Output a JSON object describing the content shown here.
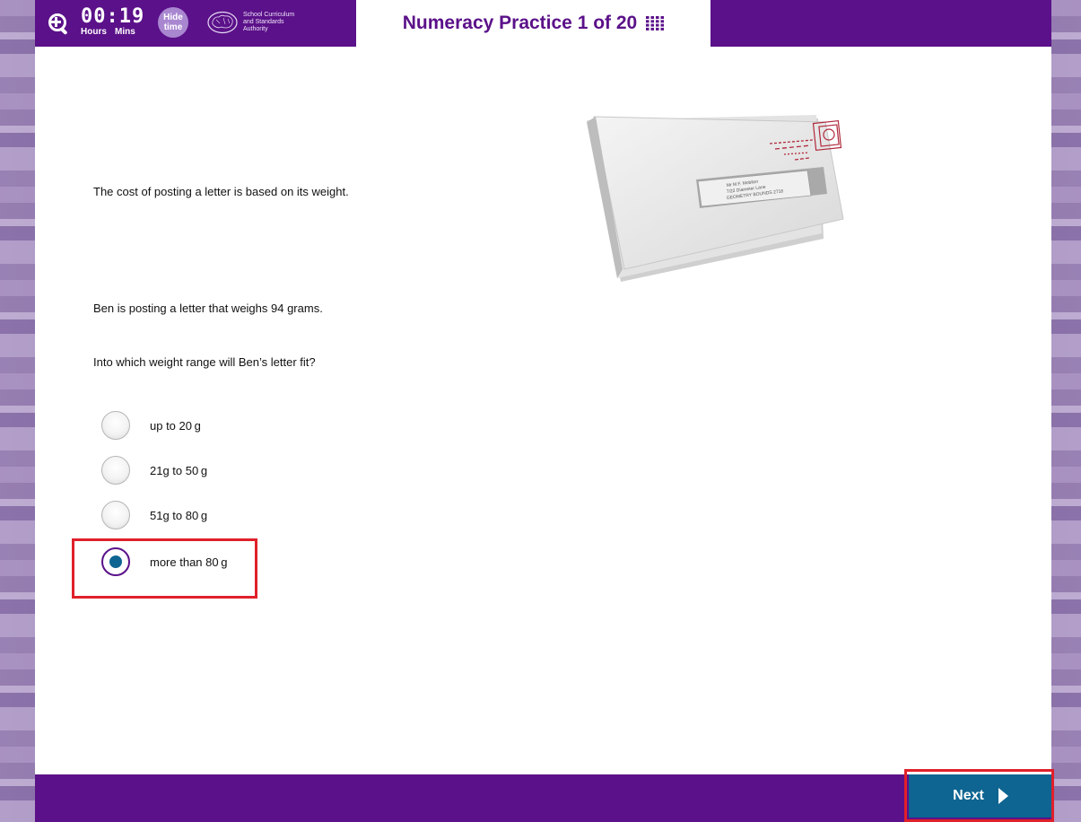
{
  "toolbar": {
    "zoom_icon": "zoom-in-icon",
    "timer_hours": "00",
    "timer_separator": ":",
    "timer_mins": "19",
    "hours_label": "Hours",
    "mins_label": "Mins",
    "hide_time_line1": "Hide",
    "hide_time_line2": "time",
    "logo_line1": "School Curriculum",
    "logo_line2": "and Standards",
    "logo_line3": "Authority",
    "title": "Numeracy Practice 1 of 20",
    "grid_icon": "question-grid-icon"
  },
  "question": {
    "intro": "The cost of posting a letter is based on its weight.",
    "detail": "Ben is posting a letter that weighs 94 grams.",
    "prompt": "Into which weight range will Ben’s letter fit?",
    "envelope_address_line1": "Mr M.F. Mobilon",
    "envelope_address_line2": "7/22 Diameter Lane",
    "envelope_address_line3": "GEOMETRY BOUNDS 2718"
  },
  "options": [
    {
      "label": "up to 20 g",
      "selected": false
    },
    {
      "label": "21g to 50 g",
      "selected": false
    },
    {
      "label": "51g to 80 g",
      "selected": false
    },
    {
      "label": "more than 80 g",
      "selected": true
    }
  ],
  "footer": {
    "next_label": "Next"
  },
  "colors": {
    "purple": "#5b1189",
    "button_blue": "#0e6591",
    "highlight_red": "#e0202a"
  }
}
